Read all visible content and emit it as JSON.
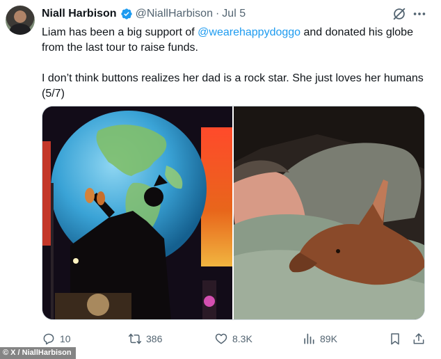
{
  "author": {
    "name": "Niall Harbison",
    "handle": "@NiallHarbison",
    "separator": "·",
    "date": "Jul 5"
  },
  "tweet": {
    "line1_before": "Liam has been a big support of ",
    "mention": "@wearehappydoggo",
    "line1_after": " and donated his globe from the last tour to raise funds.",
    "paragraph2": "I don’t think buttons realizes her dad is a rock star. She just loves her humans (5/7)"
  },
  "actions": {
    "replies": "10",
    "reposts": "386",
    "likes": "8.3K",
    "views": "89K"
  },
  "credit": "© X / NiallHarbison",
  "icons": {
    "verified": "verified-badge-icon",
    "grok": "grok-icon",
    "more": "more-icon",
    "reply": "reply-icon",
    "retweet": "retweet-icon",
    "like": "heart-icon",
    "views": "views-icon",
    "bookmark": "bookmark-icon",
    "share": "share-icon"
  },
  "colors": {
    "accent": "#1d9bf0",
    "text": "#0f1419",
    "muted": "#536471"
  }
}
